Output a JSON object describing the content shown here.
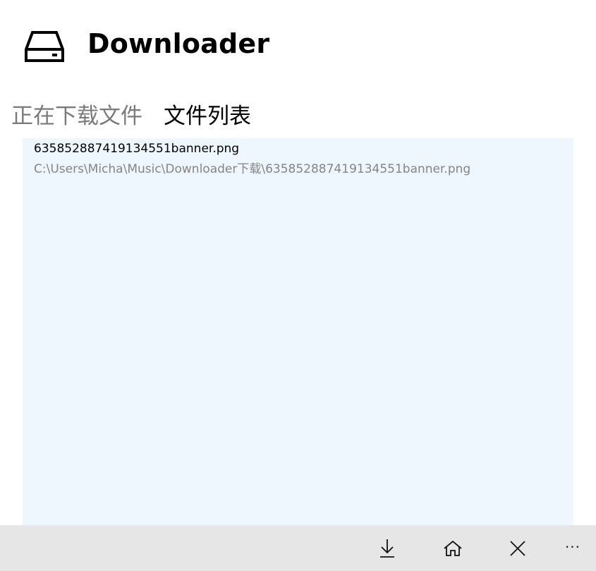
{
  "app": {
    "title": "Downloader",
    "icon": "drive-icon"
  },
  "tabs": [
    {
      "label": "正在下载文件",
      "active": false
    },
    {
      "label": "文件列表",
      "active": true
    }
  ],
  "file_list": {
    "items": [
      {
        "name": "635852887419134551banner.png",
        "path": "C:\\Users\\Micha\\Music\\Downloader下载\\635852887419134551banner.png"
      }
    ]
  },
  "command_bar": {
    "buttons": [
      {
        "name": "download",
        "icon": "download-icon"
      },
      {
        "name": "home",
        "icon": "home-icon"
      },
      {
        "name": "close",
        "icon": "close-icon"
      }
    ],
    "more_label": "···"
  },
  "colors": {
    "list_background": "#eef6fe",
    "command_bar_background": "#e6e6e6",
    "inactive_tab": "#7a7a7a",
    "path_text": "#858585"
  }
}
